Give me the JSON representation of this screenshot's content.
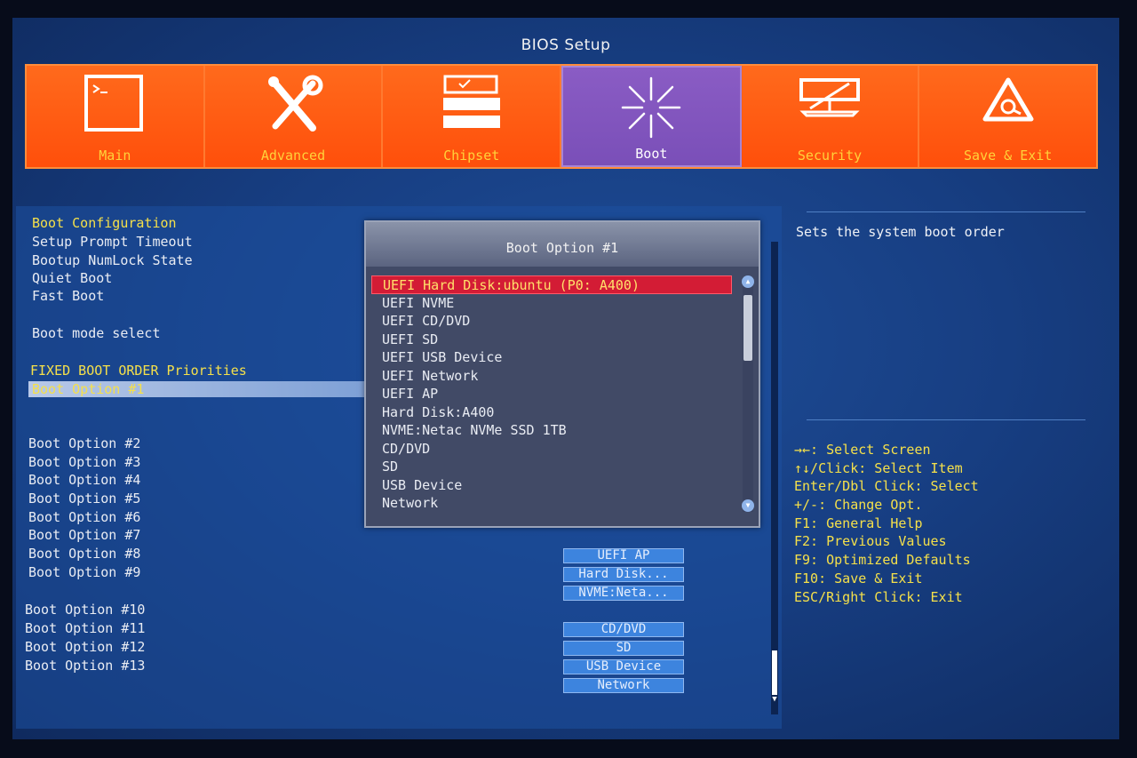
{
  "title": "BIOS Setup",
  "tabs": [
    {
      "label": "Main",
      "icon": "terminal-icon"
    },
    {
      "label": "Advanced",
      "icon": "tools-icon"
    },
    {
      "label": "Chipset",
      "icon": "chipset-icon"
    },
    {
      "label": "Boot",
      "icon": "boot-icon",
      "active": true
    },
    {
      "label": "Security",
      "icon": "security-icon"
    },
    {
      "label": "Save & Exit",
      "icon": "save-exit-icon"
    }
  ],
  "menu": [
    {
      "label": "Boot Configuration"
    },
    {
      "label": "Setup Prompt Timeout"
    },
    {
      "label": "Bootup NumLock State"
    },
    {
      "label": "Quiet Boot"
    },
    {
      "label": "Fast Boot"
    },
    {
      "label": "Boot mode select"
    },
    {
      "label": "FIXED BOOT ORDER Priorities"
    },
    {
      "label": "Boot Option #1"
    },
    {
      "label": "Boot Option #2"
    },
    {
      "label": "Boot Option #3"
    },
    {
      "label": "Boot Option #4"
    },
    {
      "label": "Boot Option #5"
    },
    {
      "label": "Boot Option #6"
    },
    {
      "label": "Boot Option #7"
    },
    {
      "label": "Boot Option #8"
    },
    {
      "label": "Boot Option #9"
    },
    {
      "label": "Boot Option #10"
    },
    {
      "label": "Boot Option #11"
    },
    {
      "label": "Boot Option #12"
    },
    {
      "label": "Boot Option #13"
    }
  ],
  "values": [
    "UEFI AP",
    "Hard Disk...",
    "NVME:Neta...",
    "CD/DVD",
    "SD",
    "USB Device",
    "Network"
  ],
  "popup": {
    "title": "Boot Option #1",
    "options": [
      "UEFI Hard Disk:ubuntu (P0: A400)",
      "UEFI NVME",
      "UEFI CD/DVD",
      "UEFI SD",
      "UEFI USB Device",
      "UEFI Network",
      "UEFI AP",
      "Hard Disk:A400",
      "NVME:Netac NVMe SSD 1TB",
      "CD/DVD",
      "SD",
      "USB Device",
      "Network"
    ],
    "selected_index": 0
  },
  "help": {
    "text": "Sets the system boot order",
    "keys": [
      "→←: Select Screen",
      "↑↓/Click: Select Item",
      "Enter/Dbl Click: Select",
      "+/-: Change Opt.",
      "F1: General Help",
      "F2: Previous Values",
      "F9: Optimized Defaults",
      "F10: Save & Exit",
      "ESC/Right Click: Exit"
    ]
  },
  "colors": {
    "tab_bg": "#ff5a12",
    "tab_active": "#7a4fb8",
    "highlight_yellow": "#f5e04a",
    "popup_selected": "#d31c35",
    "panel_blue": "#173e82"
  }
}
